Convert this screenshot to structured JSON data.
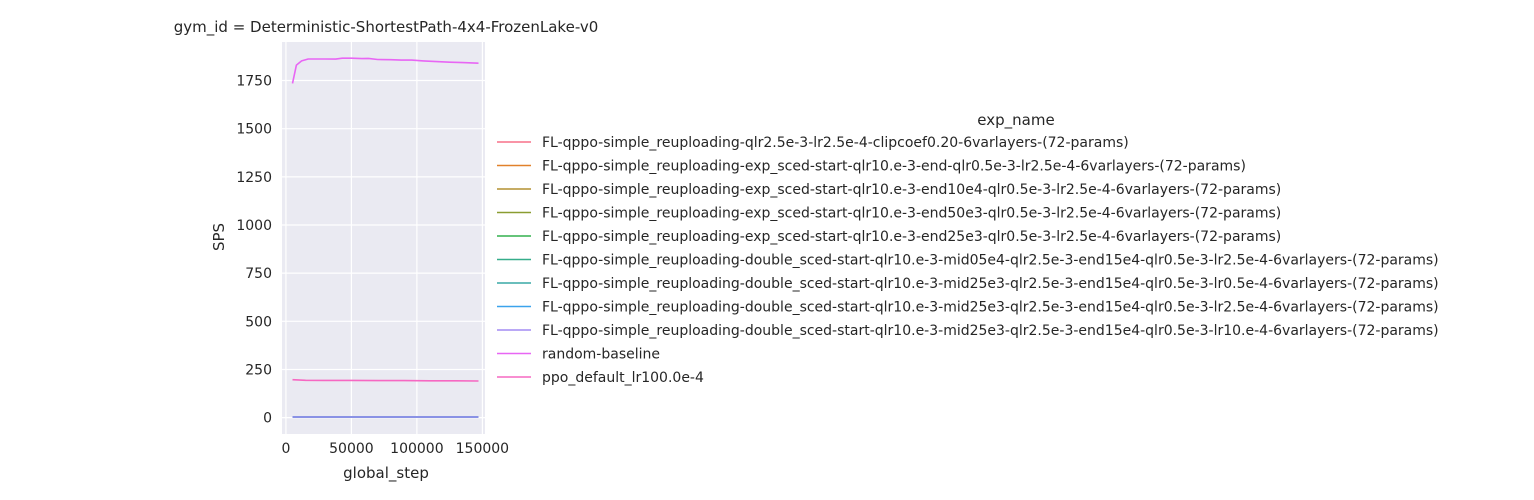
{
  "chart_data": {
    "type": "line",
    "title": "gym_id = Deterministic-ShortestPath-4x4-FrozenLake-v0",
    "xlabel": "global_step",
    "ylabel": "SPS",
    "xlim": [
      -3000,
      152000
    ],
    "ylim": [
      -85,
      1950
    ],
    "xticks": [
      0,
      50000,
      100000,
      150000
    ],
    "yticks": [
      0,
      250,
      500,
      750,
      1000,
      1250,
      1500,
      1750
    ],
    "grid": true,
    "legend_title": "exp_name",
    "legend_position": "right",
    "series": [
      {
        "name": "FL-qppo-simple_reuploading-qlr2.5e-3-lr2.5e-4-clipcoef0.20-6varlayers-(72-params)",
        "color": "#f77189",
        "x": [
          5000,
          147000
        ],
        "y": [
          3,
          3
        ]
      },
      {
        "name": "FL-qppo-simple_reuploading-exp_sced-start-qlr10.e-3-end-qlr0.5e-3-lr2.5e-4-6varlayers-(72-params)",
        "color": "#e1812b",
        "x": [
          5000,
          147000
        ],
        "y": [
          3,
          3
        ]
      },
      {
        "name": "FL-qppo-simple_reuploading-exp_sced-start-qlr10.e-3-end10e4-qlr0.5e-3-lr2.5e-4-6varlayers-(72-params)",
        "color": "#b39130",
        "x": [
          5000,
          147000
        ],
        "y": [
          3,
          3
        ]
      },
      {
        "name": "FL-qppo-simple_reuploading-exp_sced-start-qlr10.e-3-end50e3-qlr0.5e-3-lr2.5e-4-6varlayers-(72-params)",
        "color": "#8a9d31",
        "x": [
          5000,
          147000
        ],
        "y": [
          3,
          3
        ]
      },
      {
        "name": "FL-qppo-simple_reuploading-exp_sced-start-qlr10.e-3-end25e3-qlr0.5e-3-lr2.5e-4-6varlayers-(72-params)",
        "color": "#33b04f",
        "x": [
          5000,
          147000
        ],
        "y": [
          3,
          3
        ]
      },
      {
        "name": "FL-qppo-simple_reuploading-double_sced-start-qlr10.e-3-mid05e4-qlr2.5e-3-end15e4-qlr0.5e-3-lr2.5e-4-6varlayers-(72-params)",
        "color": "#36ad8a",
        "x": [
          5000,
          147000
        ],
        "y": [
          3,
          3
        ]
      },
      {
        "name": "FL-qppo-simple_reuploading-double_sced-start-qlr10.e-3-mid25e3-qlr2.5e-3-end15e4-qlr0.5e-3-lr0.5e-4-6varlayers-(72-params)",
        "color": "#38a9a5",
        "x": [
          5000,
          147000
        ],
        "y": [
          3,
          3
        ]
      },
      {
        "name": "FL-qppo-simple_reuploading-double_sced-start-qlr10.e-3-mid25e3-qlr2.5e-3-end15e4-qlr0.5e-3-lr2.5e-4-6varlayers-(72-params)",
        "color": "#3ba3ec",
        "x": [
          5000,
          147000
        ],
        "y": [
          3,
          3
        ]
      },
      {
        "name": "FL-qppo-simple_reuploading-double_sced-start-qlr10.e-3-mid25e3-qlr2.5e-3-end15e4-qlr0.5e-3-lr10.e-4-6varlayers-(72-params)",
        "color": "#a48cf4",
        "x": [
          5000,
          147000
        ],
        "y": [
          3,
          3
        ]
      },
      {
        "name": "random-baseline",
        "color": "#e866f4",
        "x": [
          5000,
          8000,
          12000,
          17000,
          22000,
          30000,
          38000,
          43000,
          50000,
          58000,
          63000,
          70000,
          80000,
          88000,
          96000,
          105000,
          115000,
          125000,
          135000,
          147000
        ],
        "y": [
          1735,
          1830,
          1852,
          1862,
          1862,
          1862,
          1861,
          1866,
          1866,
          1864,
          1865,
          1859,
          1858,
          1856,
          1856,
          1852,
          1848,
          1845,
          1843,
          1840
        ]
      },
      {
        "name": "ppo_default_lr100.0e-4",
        "color": "#f668c2",
        "x": [
          5000,
          15000,
          30000,
          50000,
          70000,
          90000,
          110000,
          130000,
          147000
        ],
        "y": [
          197,
          194,
          193,
          193,
          192,
          192,
          191,
          191,
          190
        ]
      }
    ]
  }
}
